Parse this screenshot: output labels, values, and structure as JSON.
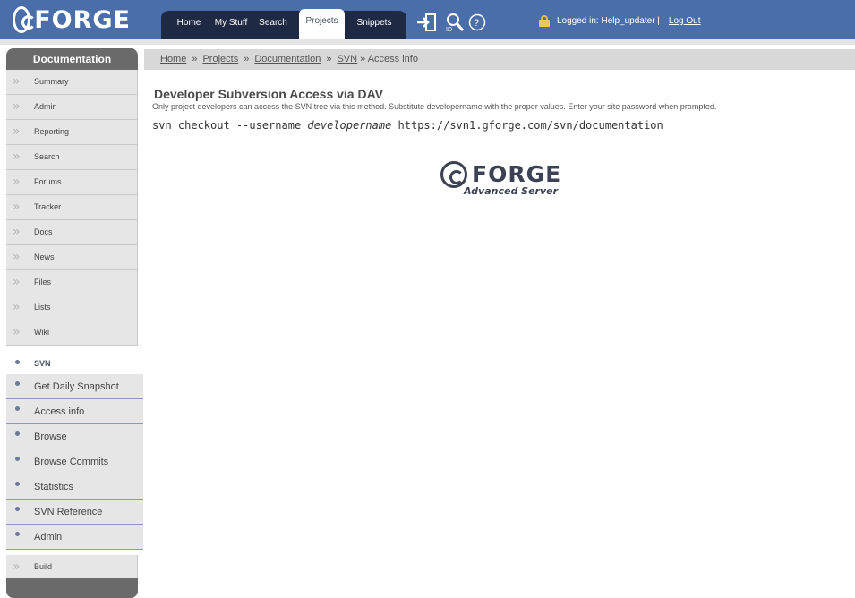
{
  "header": {
    "logo_text": "FORGE",
    "tabs": [
      {
        "label": "Home"
      },
      {
        "label": "My Stuff"
      },
      {
        "label": "Search"
      },
      {
        "label": "Projects"
      },
      {
        "label": "Snippets"
      }
    ],
    "active_tab": "Projects",
    "icons": [
      "login-icon",
      "id-search-icon",
      "help-icon"
    ],
    "login_text": "Logged in: Help_updater |",
    "logout_label": "Log Out"
  },
  "sidebar": {
    "title": "Documentation",
    "items": [
      {
        "label": "Summary"
      },
      {
        "label": "Admin"
      },
      {
        "label": "Reporting"
      },
      {
        "label": "Search"
      },
      {
        "label": "Forums"
      },
      {
        "label": "Tracker"
      },
      {
        "label": "Docs"
      },
      {
        "label": "News"
      },
      {
        "label": "Files"
      },
      {
        "label": "Lists"
      },
      {
        "label": "Wiki"
      }
    ],
    "active_item": "SVN",
    "sub_items": [
      {
        "label": "Get Daily Snapshot"
      },
      {
        "label": "Access info"
      },
      {
        "label": "Browse"
      },
      {
        "label": "Browse Commits"
      },
      {
        "label": "Statistics"
      },
      {
        "label": "SVN Reference"
      },
      {
        "label": "Admin"
      }
    ],
    "extra_item": "Build"
  },
  "breadcrumb": {
    "links": [
      "Home",
      "Projects",
      "Documentation",
      "SVN"
    ],
    "separator": "»",
    "current": "» Access info"
  },
  "main": {
    "title": "Developer Subversion Access via DAV",
    "description": "Only project developers can access the SVN tree via this method. Substitute developername with the proper values. Enter your site password when prompted.",
    "command_prefix": "svn checkout --username ",
    "command_user": "developername",
    "command_url": " https://svn1.gforge.com/svn/documentation",
    "footer_logo_text": "FORGE",
    "footer_logo_sub": "Advanced Server"
  },
  "colors": {
    "header_bg": "#4a6ea9",
    "nav_bg": "#1e2a44",
    "sidebar_head": "#6a6a6a"
  }
}
